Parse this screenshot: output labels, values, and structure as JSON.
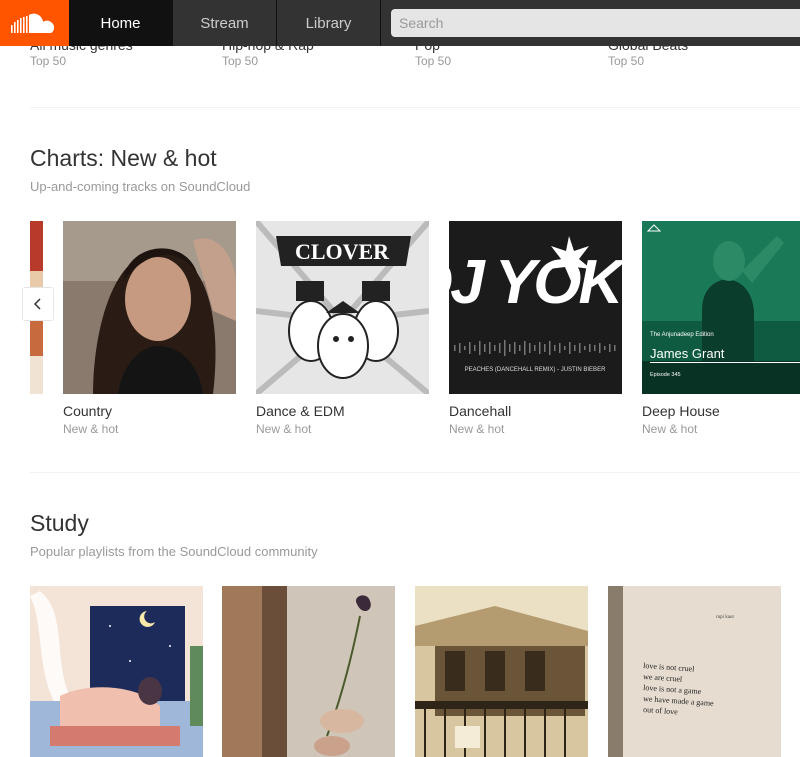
{
  "header": {
    "logo": "soundcloud-logo",
    "tabs": [
      {
        "label": "Home",
        "active": true
      },
      {
        "label": "Stream",
        "active": false
      },
      {
        "label": "Library",
        "active": false
      }
    ],
    "search_placeholder": "Search"
  },
  "previous_row": [
    {
      "title": "All music genres",
      "sub": "Top 50"
    },
    {
      "title": "Hip-hop & Rap",
      "sub": "Top 50"
    },
    {
      "title": "Pop",
      "sub": "Top 50"
    },
    {
      "title": "Global Beats",
      "sub": "Top 50"
    }
  ],
  "charts": {
    "title": "Charts: New & hot",
    "subtitle": "Up-and-coming tracks on SoundCloud",
    "prev_icon": "chevron-left-icon",
    "items": [
      {
        "title": "Country",
        "sub": "New & hot"
      },
      {
        "title": "Dance & EDM",
        "sub": "New & hot",
        "art_text": "CLOVER"
      },
      {
        "title": "Dancehall",
        "sub": "New & hot",
        "art_text": "DJ YOKO",
        "art_caption": "PEACHES (DANCEHALL REMIX) - JUSTIN BIEBER"
      },
      {
        "title": "Deep House",
        "sub": "New & hot",
        "art_edition": "The Anjunadeep Edition",
        "art_name": "James Grant",
        "art_episode": "Episode 345"
      }
    ]
  },
  "study": {
    "title": "Study",
    "subtitle": "Popular playlists from the SoundCloud community",
    "poem_author": "rupi kaur",
    "poem_lines": [
      "love is not cruel",
      "we are cruel",
      "love is not a game",
      "we have made a game",
      "out of love"
    ]
  },
  "colors": {
    "brand": "#ff5500",
    "header_bg": "#333333",
    "active_tab_bg": "#111111"
  }
}
